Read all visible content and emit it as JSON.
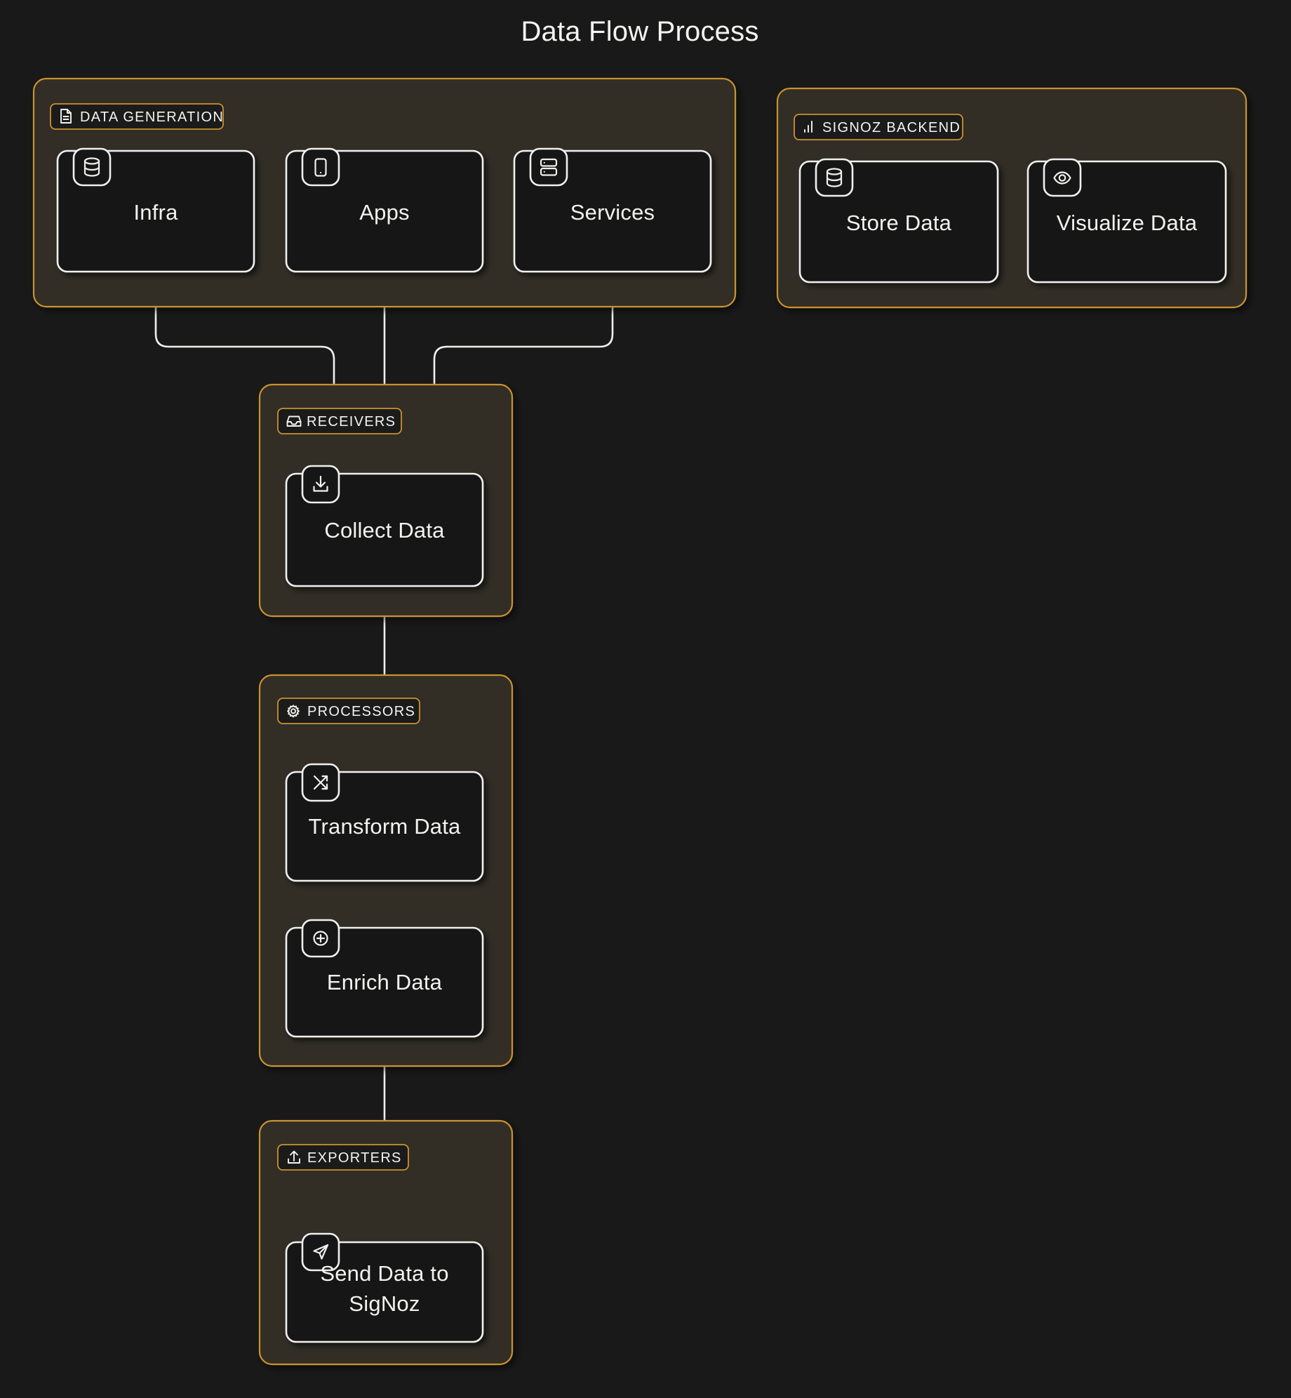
{
  "title": "Data Flow Process",
  "theme": {
    "background": "#191919",
    "group_fill": "#332e26",
    "group_border": "#c9922f",
    "node_fill": "#161616",
    "node_border": "#f0f0ee",
    "text": "#f2f2f0",
    "edge": "#f0f0ee"
  },
  "groups": [
    {
      "id": "data-generation",
      "label": "DATA GENERATION",
      "icon": "file-text-icon",
      "nodes": [
        {
          "id": "infra",
          "label": "Infra",
          "icon": "database-icon"
        },
        {
          "id": "apps",
          "label": "Apps",
          "icon": "smartphone-icon"
        },
        {
          "id": "services",
          "label": "Services",
          "icon": "server-icon"
        }
      ]
    },
    {
      "id": "signoz-backend",
      "label": "SIGNOZ BACKEND",
      "icon": "bar-chart-icon",
      "nodes": [
        {
          "id": "store-data",
          "label": "Store Data",
          "icon": "database-icon"
        },
        {
          "id": "visualize-data",
          "label": "Visualize Data",
          "icon": "eye-icon"
        }
      ]
    },
    {
      "id": "receivers",
      "label": "RECEIVERS",
      "icon": "inbox-icon",
      "nodes": [
        {
          "id": "collect-data",
          "label": "Collect Data",
          "icon": "download-icon"
        }
      ]
    },
    {
      "id": "processors",
      "label": "PROCESSORS",
      "icon": "gear-icon",
      "nodes": [
        {
          "id": "transform-data",
          "label": "Transform Data",
          "icon": "shuffle-icon"
        },
        {
          "id": "enrich-data",
          "label": "Enrich Data",
          "icon": "plus-circle-icon"
        }
      ]
    },
    {
      "id": "exporters",
      "label": "EXPORTERS",
      "icon": "upload-icon",
      "nodes": [
        {
          "id": "send-data-to-signoz",
          "label1": "Send Data to",
          "label2": "SigNoz",
          "icon": "send-icon"
        }
      ]
    }
  ],
  "edges": [
    {
      "from": "infra",
      "to": "collect-data"
    },
    {
      "from": "apps",
      "to": "collect-data"
    },
    {
      "from": "services",
      "to": "collect-data"
    },
    {
      "from": "collect-data",
      "to": "transform-data"
    },
    {
      "from": "transform-data",
      "to": "enrich-data"
    },
    {
      "from": "enrich-data",
      "to": "send-data-to-signoz"
    }
  ]
}
